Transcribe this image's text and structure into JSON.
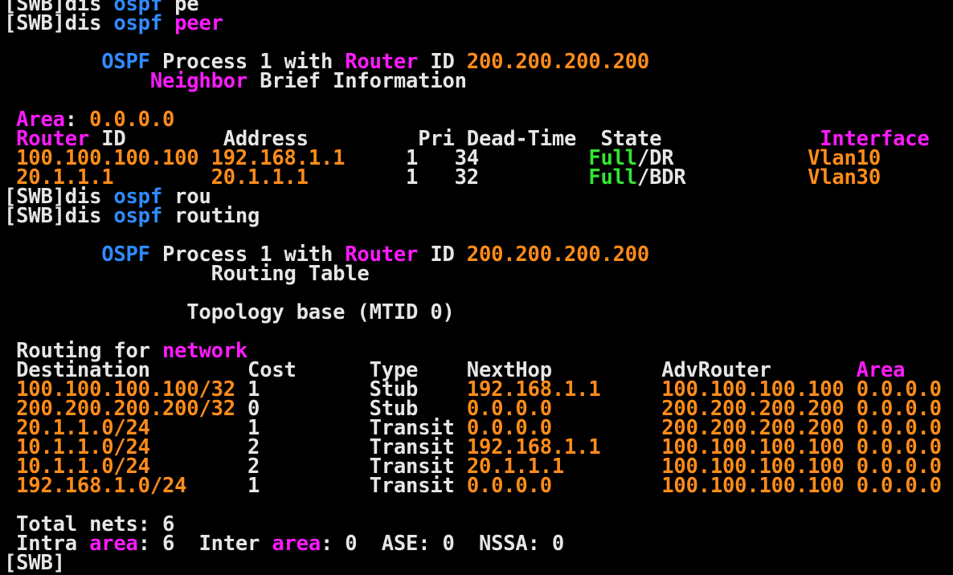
{
  "colors": {
    "background": "#000000",
    "text": "#e6e6e6",
    "keyword_blue": "#2f8cff",
    "keyword_magenta": "#ff1aff",
    "value_orange": "#ff8c1a",
    "state_green": "#33e633"
  },
  "lines": [
    [
      [
        "[SWB]dis ",
        "w"
      ],
      [
        "ospf",
        "b"
      ],
      [
        " pe",
        "w"
      ]
    ],
    [
      [
        "[SWB]dis ",
        "w"
      ],
      [
        "ospf",
        "b"
      ],
      [
        " ",
        "w"
      ],
      [
        "peer",
        "m"
      ]
    ],
    [],
    [
      [
        "        ",
        "w"
      ],
      [
        "OSPF",
        "b"
      ],
      [
        " Process 1 with ",
        "w"
      ],
      [
        "Router",
        "m"
      ],
      [
        " ID ",
        "w"
      ],
      [
        "200.200.200.200",
        "o"
      ]
    ],
    [
      [
        "            ",
        "w"
      ],
      [
        "Neighbor",
        "m"
      ],
      [
        " Brief Information",
        "w"
      ]
    ],
    [],
    [
      [
        " ",
        "w"
      ],
      [
        "Area",
        "m"
      ],
      [
        ": ",
        "w"
      ],
      [
        "0.0.0.0",
        "o"
      ]
    ],
    [
      [
        " ",
        "w"
      ],
      [
        "Router",
        "m"
      ],
      [
        " ID        Address         Pri Dead-Time  State             ",
        "w"
      ],
      [
        "Interface",
        "m"
      ]
    ],
    [
      [
        " ",
        "w"
      ],
      [
        "100.100.100.100",
        "o"
      ],
      [
        " ",
        "w"
      ],
      [
        "192.168.1.1",
        "o"
      ],
      [
        "     1   34         ",
        "w"
      ],
      [
        "Full",
        "g"
      ],
      [
        "/DR           ",
        "w"
      ],
      [
        "Vlan10",
        "o"
      ]
    ],
    [
      [
        " ",
        "w"
      ],
      [
        "20.1.1.1",
        "o"
      ],
      [
        "        ",
        "w"
      ],
      [
        "20.1.1.1",
        "o"
      ],
      [
        "        1   32         ",
        "w"
      ],
      [
        "Full",
        "g"
      ],
      [
        "/BDR          ",
        "w"
      ],
      [
        "Vlan30",
        "o"
      ]
    ],
    [
      [
        "[SWB]dis ",
        "w"
      ],
      [
        "ospf",
        "b"
      ],
      [
        " rou",
        "w"
      ]
    ],
    [
      [
        "[SWB]dis ",
        "w"
      ],
      [
        "ospf",
        "b"
      ],
      [
        " routing",
        "w"
      ]
    ],
    [],
    [
      [
        "        ",
        "w"
      ],
      [
        "OSPF",
        "b"
      ],
      [
        " Process 1 with ",
        "w"
      ],
      [
        "Router",
        "m"
      ],
      [
        " ID ",
        "w"
      ],
      [
        "200.200.200.200",
        "o"
      ]
    ],
    [
      [
        "                 Routing Table",
        "w"
      ]
    ],
    [],
    [
      [
        "               Topology base (MTID 0)",
        "w"
      ]
    ],
    [],
    [
      [
        " Routing for ",
        "w"
      ],
      [
        "network",
        "m"
      ]
    ],
    [
      [
        " Destination        Cost      Type    NextHop         AdvRouter       ",
        "w"
      ],
      [
        "Area",
        "m"
      ]
    ],
    [
      [
        " ",
        "w"
      ],
      [
        "100.100.100.100/32",
        "o"
      ],
      [
        " 1         Stub    ",
        "w"
      ],
      [
        "192.168.1.1",
        "o"
      ],
      [
        "     ",
        "w"
      ],
      [
        "100.100.100.100",
        "o"
      ],
      [
        " ",
        "w"
      ],
      [
        "0.0.0.0",
        "o"
      ]
    ],
    [
      [
        " ",
        "w"
      ],
      [
        "200.200.200.200/32",
        "o"
      ],
      [
        " 0         Stub    ",
        "w"
      ],
      [
        "0.0.0.0",
        "o"
      ],
      [
        "         ",
        "w"
      ],
      [
        "200.200.200.200",
        "o"
      ],
      [
        " ",
        "w"
      ],
      [
        "0.0.0.0",
        "o"
      ]
    ],
    [
      [
        " ",
        "w"
      ],
      [
        "20.1.1.0/24",
        "o"
      ],
      [
        "        1         Transit ",
        "w"
      ],
      [
        "0.0.0.0",
        "o"
      ],
      [
        "         ",
        "w"
      ],
      [
        "200.200.200.200",
        "o"
      ],
      [
        " ",
        "w"
      ],
      [
        "0.0.0.0",
        "o"
      ]
    ],
    [
      [
        " ",
        "w"
      ],
      [
        "10.1.1.0/24",
        "o"
      ],
      [
        "        2         Transit ",
        "w"
      ],
      [
        "192.168.1.1",
        "o"
      ],
      [
        "     ",
        "w"
      ],
      [
        "100.100.100.100",
        "o"
      ],
      [
        " ",
        "w"
      ],
      [
        "0.0.0.0",
        "o"
      ]
    ],
    [
      [
        " ",
        "w"
      ],
      [
        "10.1.1.0/24",
        "o"
      ],
      [
        "        2         Transit ",
        "w"
      ],
      [
        "20.1.1.1",
        "o"
      ],
      [
        "        ",
        "w"
      ],
      [
        "100.100.100.100",
        "o"
      ],
      [
        " ",
        "w"
      ],
      [
        "0.0.0.0",
        "o"
      ]
    ],
    [
      [
        " ",
        "w"
      ],
      [
        "192.168.1.0/24",
        "o"
      ],
      [
        "     1         Transit ",
        "w"
      ],
      [
        "0.0.0.0",
        "o"
      ],
      [
        "         ",
        "w"
      ],
      [
        "100.100.100.100",
        "o"
      ],
      [
        " ",
        "w"
      ],
      [
        "0.0.0.0",
        "o"
      ]
    ],
    [],
    [
      [
        " Total nets: 6",
        "w"
      ]
    ],
    [
      [
        " Intra ",
        "w"
      ],
      [
        "area",
        "m"
      ],
      [
        ": 6  Inter ",
        "w"
      ],
      [
        "area",
        "m"
      ],
      [
        ": 0  ASE: 0  NSSA: 0",
        "w"
      ]
    ],
    [
      [
        "[SWB]",
        "w"
      ]
    ]
  ]
}
